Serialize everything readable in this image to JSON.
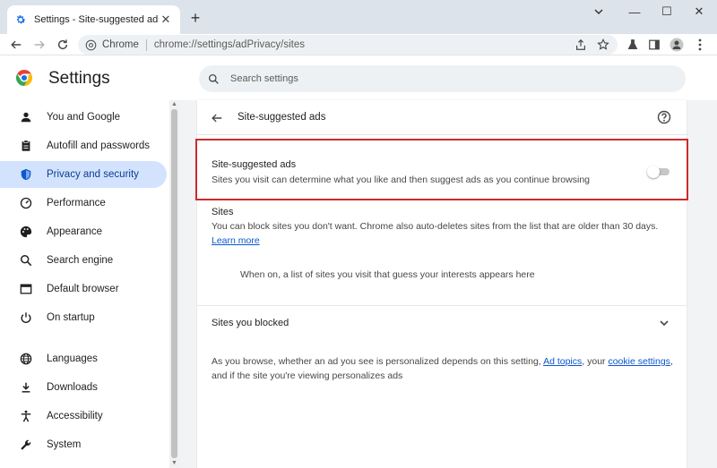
{
  "tab": {
    "title": "Settings - Site-suggested ads",
    "close": "✕",
    "favicon": "gear-icon"
  },
  "newtab": "+",
  "window_controls": {
    "minimize": "—",
    "maximize": "☐",
    "close": "✕"
  },
  "toolbar": {
    "site_label": "Chrome",
    "url": "chrome://settings/adPrivacy/sites",
    "icons": [
      "share-icon",
      "star-icon",
      "labs-icon",
      "side-panel-icon",
      "profile-icon",
      "menu-icon"
    ]
  },
  "header": {
    "title": "Settings",
    "search_placeholder": "Search settings"
  },
  "sidebar": {
    "items": [
      {
        "label": "You and Google",
        "icon": "person-icon"
      },
      {
        "label": "Autofill and passwords",
        "icon": "clipboard-icon"
      },
      {
        "label": "Privacy and security",
        "icon": "shield-icon",
        "active": true
      },
      {
        "label": "Performance",
        "icon": "speedometer-icon"
      },
      {
        "label": "Appearance",
        "icon": "palette-icon"
      },
      {
        "label": "Search engine",
        "icon": "search-icon"
      },
      {
        "label": "Default browser",
        "icon": "browser-icon"
      },
      {
        "label": "On startup",
        "icon": "power-icon"
      },
      {
        "label": "Languages",
        "icon": "globe-icon"
      },
      {
        "label": "Downloads",
        "icon": "download-icon"
      },
      {
        "label": "Accessibility",
        "icon": "accessibility-icon"
      },
      {
        "label": "System",
        "icon": "wrench-icon"
      }
    ]
  },
  "main": {
    "page_title": "Site-suggested ads",
    "toggle_row": {
      "title": "Site-suggested ads",
      "description": "Sites you visit can determine what you like and then suggest ads as you continue browsing",
      "enabled": false
    },
    "sites": {
      "title": "Sites",
      "description": "You can block sites you don't want. Chrome also auto-deletes sites from the list that are older than 30 days.",
      "learn_more": "Learn more",
      "empty_note": "When on, a list of sites you visit that guess your interests appears here"
    },
    "blocked": {
      "title": "Sites you blocked"
    },
    "footer": {
      "part1": "As you browse, whether an ad you see is personalized depends on this setting,",
      "link1": "Ad topics",
      "part2": ", your",
      "link2": "cookie settings",
      "part3": ",",
      "part4": "and if the site you're viewing personalizes ads"
    }
  },
  "colors": {
    "accent": "#0b57d0",
    "active_nav_bg": "#d3e3fd",
    "highlight_border": "#cc2b2b"
  }
}
